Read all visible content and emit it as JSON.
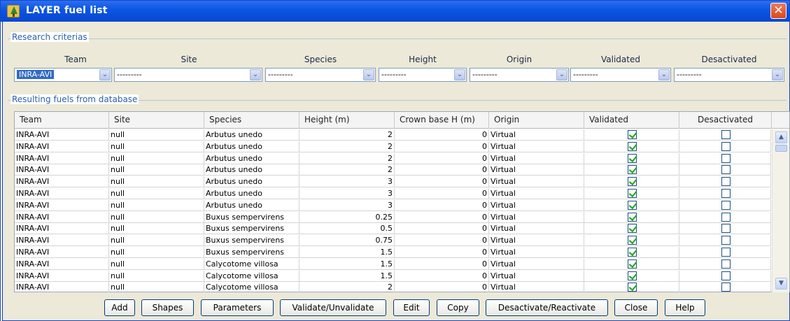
{
  "window": {
    "title": "LAYER fuel list",
    "close_glyph": "✕",
    "icon": "tree-app-icon"
  },
  "research": {
    "group_label": "Research criterias",
    "criteria": [
      {
        "label": "Team",
        "value": "INRA-AVI"
      },
      {
        "label": "Site",
        "value": "---------"
      },
      {
        "label": "Species",
        "value": "---------"
      },
      {
        "label": "Height",
        "value": "---------"
      },
      {
        "label": "Origin",
        "value": "---------"
      },
      {
        "label": "Validated",
        "value": "---------"
      },
      {
        "label": "Desactivated",
        "value": "---------"
      }
    ],
    "dropdown_glyph": "⌄"
  },
  "results": {
    "group_label": "Resulting fuels from database",
    "columns": [
      "Team",
      "Site",
      "Species",
      "Height (m)",
      "Crown base H (m)",
      "Origin",
      "Validated",
      "Desactivated"
    ],
    "rows": [
      {
        "team": "INRA-AVI",
        "site": "null",
        "species": "Arbutus unedo",
        "height": "2",
        "crown": "0",
        "origin": "Virtual",
        "validated": true,
        "desactivated": false
      },
      {
        "team": "INRA-AVI",
        "site": "null",
        "species": "Arbutus unedo",
        "height": "2",
        "crown": "0",
        "origin": "Virtual",
        "validated": true,
        "desactivated": false
      },
      {
        "team": "INRA-AVI",
        "site": "null",
        "species": "Arbutus unedo",
        "height": "2",
        "crown": "0",
        "origin": "Virtual",
        "validated": true,
        "desactivated": false
      },
      {
        "team": "INRA-AVI",
        "site": "null",
        "species": "Arbutus unedo",
        "height": "2",
        "crown": "0",
        "origin": "Virtual",
        "validated": true,
        "desactivated": false
      },
      {
        "team": "INRA-AVI",
        "site": "null",
        "species": "Arbutus unedo",
        "height": "3",
        "crown": "0",
        "origin": "Virtual",
        "validated": true,
        "desactivated": false
      },
      {
        "team": "INRA-AVI",
        "site": "null",
        "species": "Arbutus unedo",
        "height": "3",
        "crown": "0",
        "origin": "Virtual",
        "validated": true,
        "desactivated": false
      },
      {
        "team": "INRA-AVI",
        "site": "null",
        "species": "Arbutus unedo",
        "height": "3",
        "crown": "0",
        "origin": "Virtual",
        "validated": true,
        "desactivated": false
      },
      {
        "team": "INRA-AVI",
        "site": "null",
        "species": "Buxus sempervirens",
        "height": "0.25",
        "crown": "0",
        "origin": "Virtual",
        "validated": true,
        "desactivated": false
      },
      {
        "team": "INRA-AVI",
        "site": "null",
        "species": "Buxus sempervirens",
        "height": "0.5",
        "crown": "0",
        "origin": "Virtual",
        "validated": true,
        "desactivated": false
      },
      {
        "team": "INRA-AVI",
        "site": "null",
        "species": "Buxus sempervirens",
        "height": "0.75",
        "crown": "0",
        "origin": "Virtual",
        "validated": true,
        "desactivated": false
      },
      {
        "team": "INRA-AVI",
        "site": "null",
        "species": "Buxus sempervirens",
        "height": "1.5",
        "crown": "0",
        "origin": "Virtual",
        "validated": true,
        "desactivated": false
      },
      {
        "team": "INRA-AVI",
        "site": "null",
        "species": "Calycotome villosa",
        "height": "1.5",
        "crown": "0",
        "origin": "Virtual",
        "validated": true,
        "desactivated": false
      },
      {
        "team": "INRA-AVI",
        "site": "null",
        "species": "Calycotome villosa",
        "height": "1.5",
        "crown": "0",
        "origin": "Virtual",
        "validated": true,
        "desactivated": false
      },
      {
        "team": "INRA-AVI",
        "site": "null",
        "species": "Calycotome villosa",
        "height": "2",
        "crown": "0",
        "origin": "Virtual",
        "validated": true,
        "desactivated": false
      }
    ],
    "scroll_up_glyph": "▲",
    "scroll_down_glyph": "▼"
  },
  "buttons": [
    "Add",
    "Shapes",
    "Parameters",
    "Validate/Unvalidate",
    "Edit",
    "Copy",
    "Desactivate/Reactivate",
    "Close",
    "Help"
  ]
}
